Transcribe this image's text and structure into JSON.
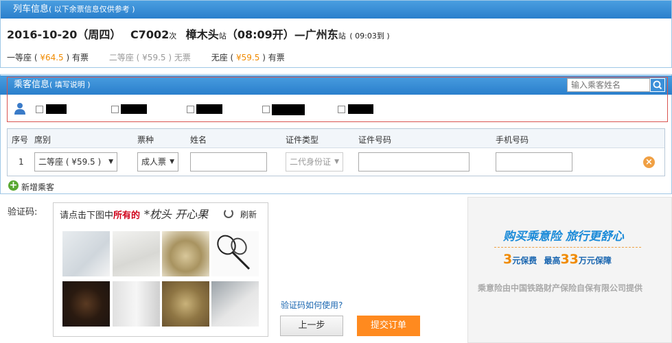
{
  "train_info": {
    "title": "列车信息",
    "note": "( 以下余票信息仅供参考 )",
    "date": "2016-10-20（周四）",
    "train_no": "C7002",
    "train_suffix": "次",
    "from_station": "樟木头",
    "station_suffix": "站",
    "depart": "（08:09开）",
    "dash": "—",
    "to_station": "广州东",
    "arrive": "( 09:03到 )",
    "seats": [
      {
        "name": "一等座",
        "price": "¥64.5",
        "status": "有票",
        "available": true
      },
      {
        "name": "二等座",
        "price": "¥59.5",
        "status": "无票",
        "available": false
      },
      {
        "name": "无座",
        "price": "¥59.5",
        "status": "有票",
        "available": true
      }
    ]
  },
  "passenger_info": {
    "title": "乘客信息",
    "help": "( 填写说明 )",
    "search_placeholder": "输入乘客姓名"
  },
  "table": {
    "headers": [
      "序号",
      "席别",
      "票种",
      "姓名",
      "证件类型",
      "证件号码",
      "手机号码"
    ],
    "row": {
      "index": "1",
      "seat": "二等座 ( ¥59.5 )",
      "ticket_type": "成人票",
      "name": "",
      "id_type": "二代身份证",
      "id_number": "",
      "phone": ""
    }
  },
  "add_passenger": "新增乘客",
  "captcha": {
    "label": "验证码:",
    "instruction_prefix": "请点击下图中",
    "instruction_bold": "所有的",
    "handwritten": "*枕头  开心果",
    "refresh": "刷新",
    "help_link": "验证码如何使用?"
  },
  "buttons": {
    "prev": "上一步",
    "submit": "提交订单"
  },
  "ad": {
    "title": "购买乘意险  旅行更舒心",
    "premium_num": "3",
    "premium_text": "元保费",
    "max_prefix": "最高",
    "max_num": "33",
    "max_text": "万元保障",
    "footer": "乘意险由中国铁路财产保险自保有限公司提供"
  },
  "colors": {
    "header_blue": "#2a7fcc",
    "accent_orange": "#f08a00",
    "submit_orange": "#ff8a1f"
  }
}
